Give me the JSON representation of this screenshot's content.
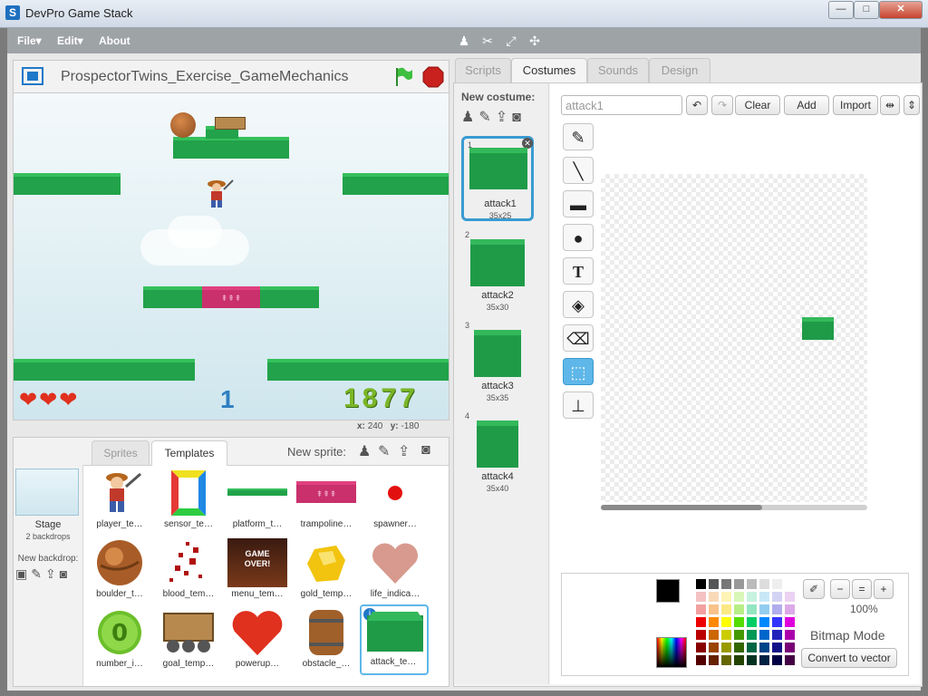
{
  "window": {
    "title": "DevPro Game Stack",
    "minimize": "—",
    "maximize": "□",
    "close": "✕"
  },
  "menu": {
    "file": "File▾",
    "edit": "Edit▾",
    "about": "About"
  },
  "project": {
    "title": "ProspectorTwins_Exercise_GameMechanics"
  },
  "hud": {
    "level": "1",
    "score": "1877",
    "lives": 3
  },
  "coords": {
    "x_label": "x:",
    "x_value": "240",
    "y_label": "y:",
    "y_value": "-180"
  },
  "sprites_panel": {
    "tabs": [
      "Sprites",
      "Templates"
    ],
    "new_sprite_label": "New sprite:",
    "stage": {
      "label": "Stage",
      "backdrops": "2 backdrops",
      "new_backdrop": "New backdrop:"
    },
    "templates": [
      "player_te…",
      "sensor_te…",
      "platform_t…",
      "trampoline…",
      "spawner…",
      "boulder_t…",
      "blood_tem…",
      "menu_tem…",
      "gold_temp…",
      "life_indica…",
      "number_i…",
      "goal_temp…",
      "powerup…",
      "obstacle_…",
      "attack_te…"
    ],
    "menu_thumb": {
      "line1": "GAME",
      "line2": "OVER!"
    },
    "number_thumb": "0"
  },
  "editor": {
    "tabs": [
      "Scripts",
      "Costumes",
      "Sounds",
      "Design"
    ],
    "active_tab": "Costumes",
    "new_costume_label": "New costume:",
    "costume_name": "attack1",
    "buttons": {
      "clear": "Clear",
      "add": "Add",
      "import": "Import"
    },
    "costumes": [
      {
        "num": "1",
        "name": "attack1",
        "size": "35x25"
      },
      {
        "num": "2",
        "name": "attack2",
        "size": "35x30"
      },
      {
        "num": "3",
        "name": "attack3",
        "size": "35x35"
      },
      {
        "num": "4",
        "name": "attack4",
        "size": "35x40"
      }
    ],
    "tools": [
      "brush-icon",
      "line-icon",
      "rectangle-icon",
      "ellipse-icon",
      "text-icon",
      "fill-icon",
      "eraser-icon",
      "select-icon",
      "stamp-icon"
    ],
    "text_tool_glyph": "T",
    "zoom": "100%",
    "mode": "Bitmap Mode",
    "convert": "Convert to vector",
    "accent_color": "#5eb7e8",
    "costume_green": "#1f9b48"
  }
}
